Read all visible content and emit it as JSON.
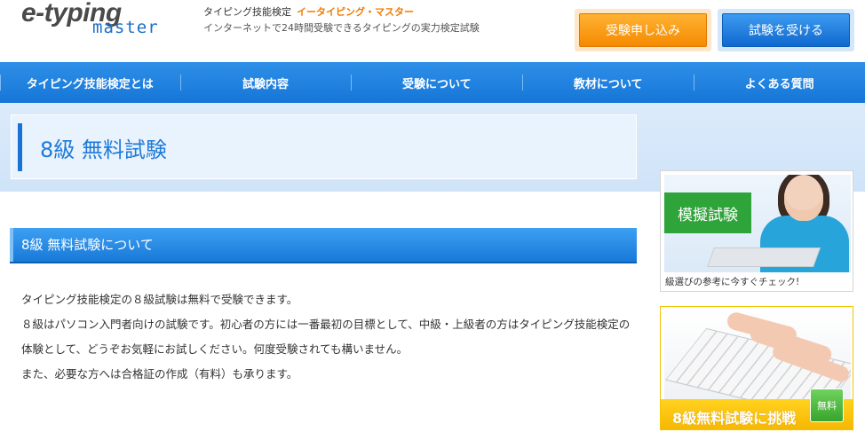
{
  "header": {
    "logo_top": "e-typing",
    "logo_bottom": "master",
    "tagline_label": "タイピング技能検定",
    "tagline_brand": "イータイピング・マスター",
    "tagline_sub": "インターネットで24時間受験できるタイピングの実力検定試験",
    "apply_button": "受験申し込み",
    "take_button": "試験を受ける"
  },
  "nav": {
    "items": [
      {
        "label": "タイピング技能検定とは"
      },
      {
        "label": "試験内容"
      },
      {
        "label": "受験について"
      },
      {
        "label": "教材について"
      },
      {
        "label": "よくある質問"
      }
    ]
  },
  "page": {
    "title": "8級 無料試験",
    "section_title": "8級 無料試験について",
    "paragraphs": [
      "タイピング技能検定の８級試験は無料で受験できます。",
      "８級はパソコン入門者向けの試験です。初心者の方には一番最初の目標として、中級・上級者の方はタイピング技能検定の体験として、どうぞお気軽にお試しください。何度受験されても構いません。",
      "また、必要な方へは合格証の作成（有料）も承ります。"
    ]
  },
  "sidebar": {
    "mock_label": "模擬試験",
    "mock_caption": "級選びの参考に今すぐチェック!",
    "free_exam_label": "8級無料試験に挑戦",
    "free_badge": "無料"
  },
  "colors": {
    "nav_blue": "#1676d8",
    "accent_orange": "#f58a00",
    "title_blue": "#1f7ad8",
    "mock_green": "#2fa43a",
    "free_yellow": "#f6b600"
  }
}
